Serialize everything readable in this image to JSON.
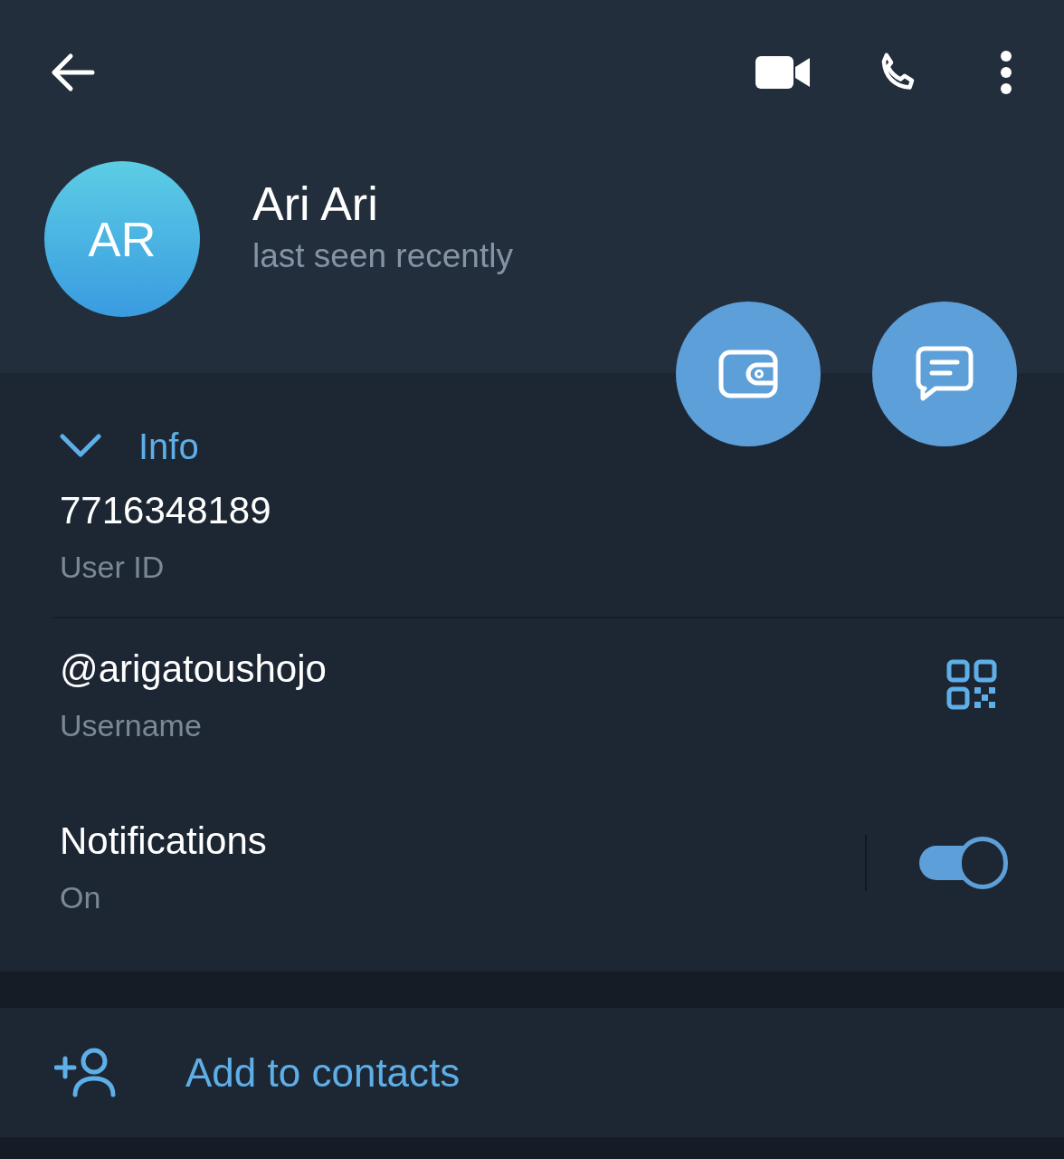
{
  "profile": {
    "initials": "AR",
    "name": "Ari Ari",
    "status": "last seen recently"
  },
  "info": {
    "title": "Info",
    "expanded": true,
    "rows": [
      {
        "kind": "text",
        "value": "7716348189",
        "label": "User ID"
      },
      {
        "kind": "qr",
        "value": "@arigatoushojo",
        "label": "Username"
      },
      {
        "kind": "toggle",
        "value": "Notifications",
        "label": "On",
        "on": true
      }
    ]
  },
  "actions": [
    {
      "kind": "add-contact",
      "label": "Add to contacts"
    }
  ]
}
